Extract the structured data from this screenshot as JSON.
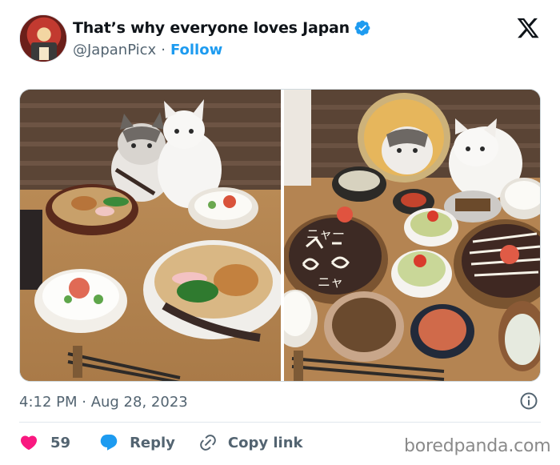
{
  "author": {
    "display_name": "That’s why everyone loves Japan",
    "handle": "@JapanPicx",
    "separator": "·",
    "follow_label": "Follow"
  },
  "post": {
    "timestamp": "4:12 PM · Aug 28, 2023"
  },
  "actions": {
    "like_count": "59",
    "reply_label": "Reply",
    "copy_link_label": "Copy link"
  },
  "media": {
    "left_photo_text": "",
    "right_photo_text": [
      "ニャー",
      "ニャ"
    ]
  },
  "watermark": "boredpanda.com",
  "icons": {
    "verified": "verified-badge-icon",
    "platform": "x-logo-icon",
    "info": "info-icon",
    "like": "heart-icon",
    "reply": "speech-bubble-icon",
    "copy": "link-icon"
  },
  "colors": {
    "accent": "#1d9bf0",
    "like": "#f91880",
    "text": "#0f1419",
    "muted": "#536471"
  }
}
